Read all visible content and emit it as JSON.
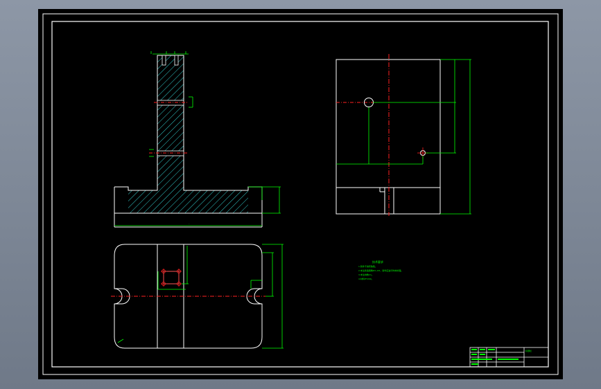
{
  "colors": {
    "viewport_bg": "#7d8796",
    "sheet": "#000000",
    "border": "#ffffff",
    "part_outline": "#ffffff",
    "dimension": "#00ff00",
    "center_line": "#ff2020",
    "hatch": "#33cccc",
    "note_text": "#00ff00"
  },
  "notes": {
    "title": "技术要求",
    "lines": [
      "1.铸件不得有缺陷。",
      "2.未注铸造圆角R3~R5，铸件应进行时效处理。",
      "3.未注倒角C1。",
      "4.材料HT200。"
    ]
  },
  "title_block": {
    "label": "标题栏"
  }
}
